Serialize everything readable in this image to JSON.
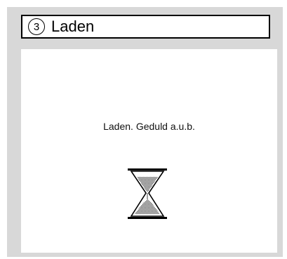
{
  "header": {
    "step_number": "3",
    "title": "Laden"
  },
  "content": {
    "message": "Laden. Geduld a.u.b.",
    "icon": "hourglass-icon"
  },
  "colors": {
    "panel_background": "#d8d8d8",
    "content_background": "#ffffff",
    "border": "#000000"
  }
}
